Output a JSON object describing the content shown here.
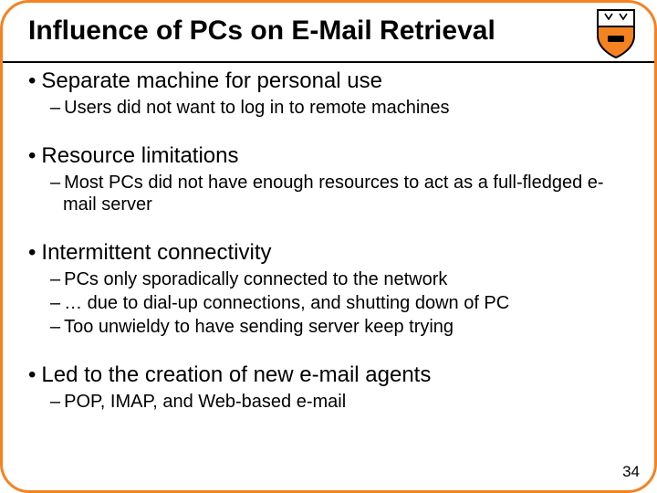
{
  "title": "Influence of PCs on E-Mail Retrieval",
  "slide_number": "34",
  "logo": {
    "name": "princeton-shield-icon"
  },
  "bullets": [
    {
      "text": "Separate machine for personal use",
      "subs": [
        "Users did not want to log in to remote machines"
      ]
    },
    {
      "text": "Resource limitations",
      "subs": [
        "Most PCs did not have enough resources to act as a full-fledged e-mail server"
      ]
    },
    {
      "text": "Intermittent connectivity",
      "subs": [
        "PCs only sporadically connected to the network",
        "… due to dial-up connections, and shutting down of PC",
        "Too unwieldy to have sending server keep trying"
      ]
    },
    {
      "text": "Led to the creation of new e-mail agents",
      "subs": [
        "POP, IMAP, and Web-based e-mail"
      ]
    }
  ]
}
